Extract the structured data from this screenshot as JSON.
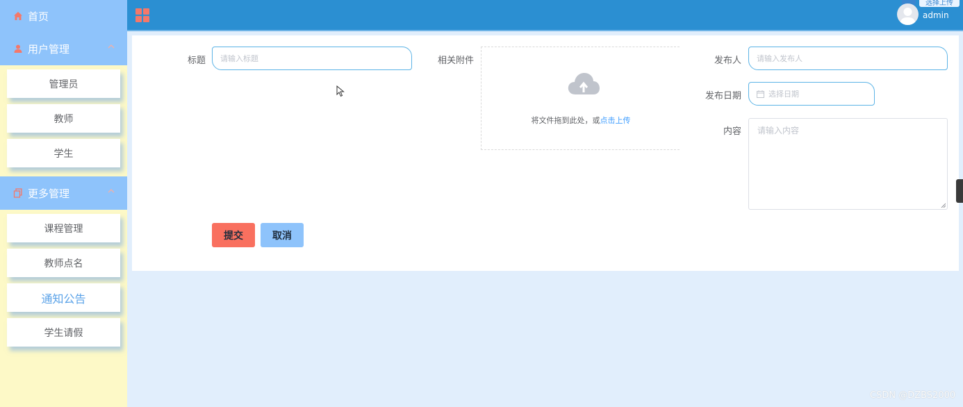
{
  "sidebar": {
    "home_label": "首页",
    "groups": [
      {
        "label": "用户管理",
        "items": [
          "管理员",
          "教师",
          "学生"
        ]
      },
      {
        "label": "更多管理",
        "items": [
          "课程管理",
          "教师点名",
          "通知公告",
          "学生请假"
        ],
        "active_index": 2
      }
    ]
  },
  "header": {
    "user_name": "admin",
    "corner_badge": "选择上传"
  },
  "form": {
    "title_label": "标题",
    "title_placeholder": "请输入标题",
    "attachment_label": "相关附件",
    "upload_hint": "将文件拖到此处，或",
    "upload_link": "点击上传",
    "publisher_label": "发布人",
    "publisher_placeholder": "请输入发布人",
    "date_label": "发布日期",
    "date_placeholder": "选择日期",
    "content_label": "内容",
    "content_placeholder": "请输入内容",
    "submit_label": "提交",
    "cancel_label": "取消"
  },
  "watermark": "CSDN @DZBS2000",
  "colors": {
    "sidebar_header": "#8ec3fb",
    "sidebar_bg": "#fdf9c7",
    "topbar": "#2b8fd2",
    "submit": "#f9705f",
    "cancel": "#8ec3fb",
    "active_item": "#5aa2e8"
  }
}
